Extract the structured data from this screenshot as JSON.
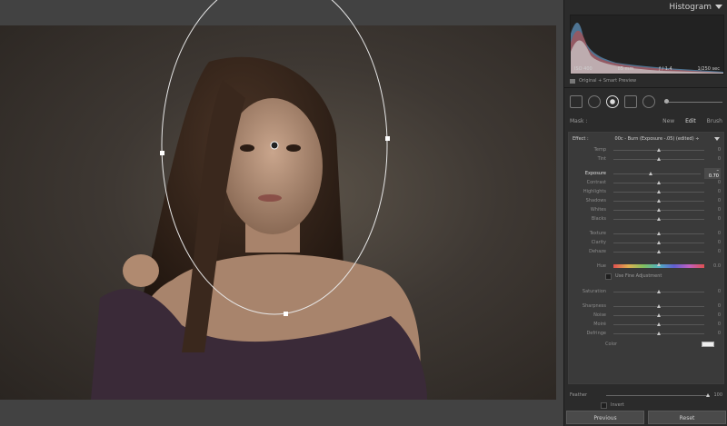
{
  "histogram": {
    "title": "Histogram",
    "iso": "ISO 400",
    "focal": "85 mm",
    "aperture": "ƒ / 1.4",
    "shutter": "1/250 sec",
    "preview_label": "Original + Smart Preview"
  },
  "mask": {
    "label": "Mask :",
    "modes": [
      "New",
      "Edit",
      "Brush"
    ],
    "active_mode": "Edit"
  },
  "effect": {
    "label": "Effect :",
    "preset": "00c - Burn (Exposure -.05) (edited) ÷",
    "sliders": [
      {
        "name": "temp",
        "label": "Temp",
        "value": "0",
        "pos": 0.5
      },
      {
        "name": "tint",
        "label": "Tint",
        "value": "0",
        "pos": 0.5
      },
      {
        "name": "exposure",
        "label": "Exposure",
        "value": "– 0.70",
        "pos": 0.43
      },
      {
        "name": "contrast",
        "label": "Contrast",
        "value": "0",
        "pos": 0.5
      },
      {
        "name": "highlights",
        "label": "Highlights",
        "value": "0",
        "pos": 0.5
      },
      {
        "name": "shadows",
        "label": "Shadows",
        "value": "0",
        "pos": 0.5
      },
      {
        "name": "whites",
        "label": "Whites",
        "value": "0",
        "pos": 0.5
      },
      {
        "name": "blacks",
        "label": "Blacks",
        "value": "0",
        "pos": 0.5
      },
      {
        "name": "texture",
        "label": "Texture",
        "value": "0",
        "pos": 0.5
      },
      {
        "name": "clarity",
        "label": "Clarity",
        "value": "0",
        "pos": 0.5
      },
      {
        "name": "dehaze",
        "label": "Dehaze",
        "value": "0",
        "pos": 0.5
      },
      {
        "name": "hue",
        "label": "Hue",
        "value": "0.0",
        "pos": 0.5
      },
      {
        "name": "saturation",
        "label": "Saturation",
        "value": "0",
        "pos": 0.5
      },
      {
        "name": "sharpness",
        "label": "Sharpness",
        "value": "0",
        "pos": 0.5
      },
      {
        "name": "noise",
        "label": "Noise",
        "value": "0",
        "pos": 0.5
      },
      {
        "name": "moire",
        "label": "Moiré",
        "value": "0",
        "pos": 0.5
      },
      {
        "name": "defringe",
        "label": "Defringe",
        "value": "0",
        "pos": 0.5
      }
    ],
    "fine_adjustment": "Use Fine Adjustment",
    "color_label": "Color"
  },
  "feather": {
    "label": "Feather",
    "value": "100",
    "pos": 1.0
  },
  "invert_label": "Invert",
  "buttons": {
    "previous": "Previous",
    "reset": "Reset"
  }
}
